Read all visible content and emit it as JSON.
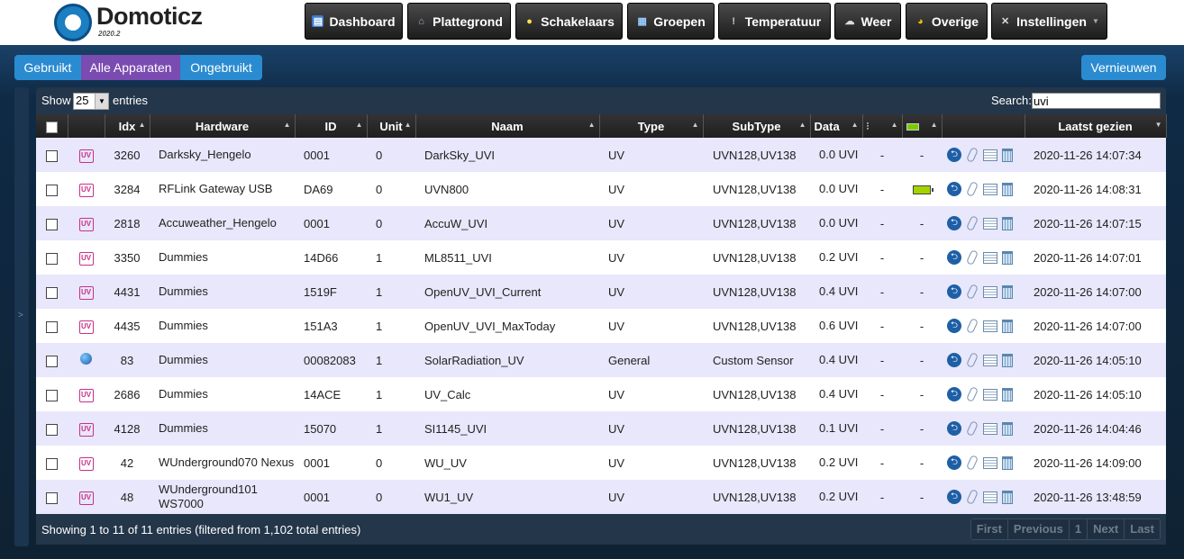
{
  "app": {
    "name": "Domoticz",
    "version": "2020.2"
  },
  "nav": [
    {
      "label": "Dashboard",
      "icon": "dashboard-icon"
    },
    {
      "label": "Plattegrond",
      "icon": "floorplan-icon"
    },
    {
      "label": "Schakelaars",
      "icon": "lightbulb-icon"
    },
    {
      "label": "Groepen",
      "icon": "scene-icon"
    },
    {
      "label": "Temperatuur",
      "icon": "thermometer-icon"
    },
    {
      "label": "Weer",
      "icon": "weather-icon"
    },
    {
      "label": "Overige",
      "icon": "utility-icon"
    },
    {
      "label": "Instellingen",
      "icon": "tools-icon"
    }
  ],
  "filters": {
    "used": "Gebruikt",
    "all": "Alle Apparaten",
    "unused": "Ongebruikt",
    "active": "all"
  },
  "refresh_label": "Vernieuwen",
  "table_controls": {
    "show": "Show",
    "page_size": "25",
    "entries": "entries",
    "search_label": "Search:",
    "search_value": "uvi"
  },
  "columns": [
    "Idx",
    "Hardware",
    "ID",
    "Unit",
    "Naam",
    "Type",
    "SubType",
    "Data",
    "",
    "",
    "",
    "Laatst gezien"
  ],
  "rows": [
    {
      "icon": "uv-icon",
      "idx": "3260",
      "hardware": "Darksky_Hengelo",
      "id": "0001",
      "unit": "0",
      "name": "DarkSky_UVI",
      "type": "UV",
      "subtype": "UVN128,UV138",
      "data": "0.0 UVI",
      "signal": "-",
      "battery": "-",
      "last_seen": "2020-11-26 14:07:34"
    },
    {
      "icon": "uv-icon",
      "idx": "3284",
      "hardware": "RFLink Gateway USB",
      "id": "DA69",
      "unit": "0",
      "name": "UVN800",
      "type": "UV",
      "subtype": "UVN128,UV138",
      "data": "0.0 UVI",
      "signal": "-",
      "battery": "battery-full-icon",
      "last_seen": "2020-11-26 14:08:31"
    },
    {
      "icon": "uv-icon",
      "idx": "2818",
      "hardware": "Accuweather_Hengelo",
      "id": "0001",
      "unit": "0",
      "name": "AccuW_UVI",
      "type": "UV",
      "subtype": "UVN128,UV138",
      "data": "0.0 UVI",
      "signal": "-",
      "battery": "-",
      "last_seen": "2020-11-26 14:07:15"
    },
    {
      "icon": "uv-icon",
      "idx": "3350",
      "hardware": "Dummies",
      "id": "14D66",
      "unit": "1",
      "name": "ML8511_UVI",
      "type": "UV",
      "subtype": "UVN128,UV138",
      "data": "0.2 UVI",
      "signal": "-",
      "battery": "-",
      "last_seen": "2020-11-26 14:07:01"
    },
    {
      "icon": "uv-icon",
      "idx": "4431",
      "hardware": "Dummies",
      "id": "1519F",
      "unit": "1",
      "name": "OpenUV_UVI_Current",
      "type": "UV",
      "subtype": "UVN128,UV138",
      "data": "0.4 UVI",
      "signal": "-",
      "battery": "-",
      "last_seen": "2020-11-26 14:07:00"
    },
    {
      "icon": "uv-icon",
      "idx": "4435",
      "hardware": "Dummies",
      "id": "151A3",
      "unit": "1",
      "name": "OpenUV_UVI_MaxToday",
      "type": "UV",
      "subtype": "UVN128,UV138",
      "data": "0.6 UVI",
      "signal": "-",
      "battery": "-",
      "last_seen": "2020-11-26 14:07:00"
    },
    {
      "icon": "globe-icon",
      "idx": "83",
      "hardware": "Dummies",
      "id": "00082083",
      "unit": "1",
      "name": "SolarRadiation_UV",
      "type": "General",
      "subtype": "Custom Sensor",
      "data": "0.4 UVI",
      "signal": "-",
      "battery": "-",
      "last_seen": "2020-11-26 14:05:10"
    },
    {
      "icon": "uv-icon",
      "idx": "2686",
      "hardware": "Dummies",
      "id": "14ACE",
      "unit": "1",
      "name": "UV_Calc",
      "type": "UV",
      "subtype": "UVN128,UV138",
      "data": "0.4 UVI",
      "signal": "-",
      "battery": "-",
      "last_seen": "2020-11-26 14:05:10"
    },
    {
      "icon": "uv-icon",
      "idx": "4128",
      "hardware": "Dummies",
      "id": "15070",
      "unit": "1",
      "name": "SI1145_UVI",
      "type": "UV",
      "subtype": "UVN128,UV138",
      "data": "0.1 UVI",
      "signal": "-",
      "battery": "-",
      "last_seen": "2020-11-26 14:04:46"
    },
    {
      "icon": "uv-icon",
      "idx": "42",
      "hardware": "WUnderground070 Nexus",
      "id": "0001",
      "unit": "0",
      "name": "WU_UV",
      "type": "UV",
      "subtype": "UVN128,UV138",
      "data": "0.2 UVI",
      "signal": "-",
      "battery": "-",
      "last_seen": "2020-11-26 14:09:00"
    },
    {
      "icon": "uv-icon",
      "idx": "48",
      "hardware": "WUnderground101 WS7000",
      "id": "0001",
      "unit": "0",
      "name": "WU1_UV",
      "type": "UV",
      "subtype": "UVN128,UV138",
      "data": "0.2 UVI",
      "signal": "-",
      "battery": "-",
      "last_seen": "2020-11-26 13:48:59"
    }
  ],
  "footer": {
    "info": "Showing 1 to 11 of 11 entries (filtered from 1,102 total entries)",
    "pager": {
      "first": "First",
      "previous": "Previous",
      "page": "1",
      "next": "Next",
      "last": "Last"
    }
  },
  "colors": {
    "filter_active": "#7a4bb0",
    "filter_button": "#2a8bd0",
    "uv_icon": "#c8308a",
    "row_odd": "#e8e7fb"
  }
}
